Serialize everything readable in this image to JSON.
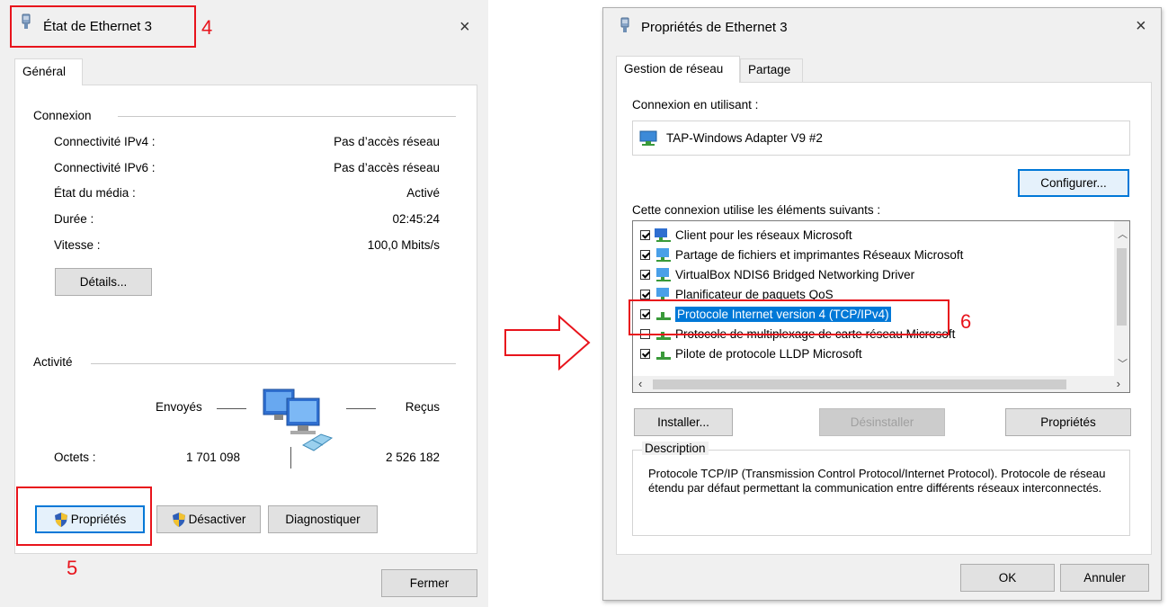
{
  "status_dialog": {
    "title": "État de Ethernet 3",
    "tab": "Général",
    "connection_group": "Connexion",
    "rows": [
      {
        "label": "Connectivité IPv4 :",
        "value": "Pas d’accès réseau"
      },
      {
        "label": "Connectivité IPv6 :",
        "value": "Pas d’accès réseau"
      },
      {
        "label": "État du média :",
        "value": "Activé"
      },
      {
        "label": "Durée :",
        "value": "02:45:24"
      },
      {
        "label": "Vitesse :",
        "value": "100,0 Mbits/s"
      }
    ],
    "details_button": "Détails...",
    "activity_group": "Activité",
    "sent_label": "Envoyés",
    "received_label": "Reçus",
    "bytes_label": "Octets :",
    "bytes_sent": "1 701 098",
    "bytes_received": "2 526 182",
    "properties_button": "Propriétés",
    "disable_button": "Désactiver",
    "diagnose_button": "Diagnostiquer",
    "close_button": "Fermer",
    "close_icon": "×"
  },
  "props_dialog": {
    "title": "Propriétés de Ethernet 3",
    "tabs": [
      "Gestion de réseau",
      "Partage"
    ],
    "connect_using_label": "Connexion en utilisant :",
    "adapter": "TAP-Windows Adapter V9 #2",
    "configure_button": "Configurer...",
    "items_label": "Cette connexion utilise les éléments suivants :",
    "items": [
      {
        "label": "Client pour les réseaux Microsoft",
        "checked": true
      },
      {
        "label": "Partage de fichiers et imprimantes Réseaux Microsoft",
        "checked": true
      },
      {
        "label": "VirtualBox NDIS6 Bridged Networking Driver",
        "checked": true
      },
      {
        "label": "Planificateur de paquets QoS",
        "checked": true
      },
      {
        "label": "Protocole Internet version 4 (TCP/IPv4)",
        "checked": true,
        "selected": true
      },
      {
        "label": "Protocole de multiplexage de carte réseau Microsoft",
        "checked": false
      },
      {
        "label": "Pilote de protocole LLDP Microsoft",
        "checked": true
      }
    ],
    "install_button": "Installer...",
    "uninstall_button": "Désinstaller",
    "properties_button": "Propriétés",
    "description_label": "Description",
    "description_text": "Protocole TCP/IP (Transmission Control Protocol/Internet Protocol). Protocole de réseau étendu par défaut permettant la communication entre différents réseaux interconnectés.",
    "ok_button": "OK",
    "cancel_button": "Annuler",
    "close_icon": "×"
  },
  "annotations": {
    "step4": "4",
    "step5": "5",
    "step6": "6"
  },
  "colors": {
    "annotation_red": "#e8141c",
    "selection_blue": "#0078d7"
  }
}
